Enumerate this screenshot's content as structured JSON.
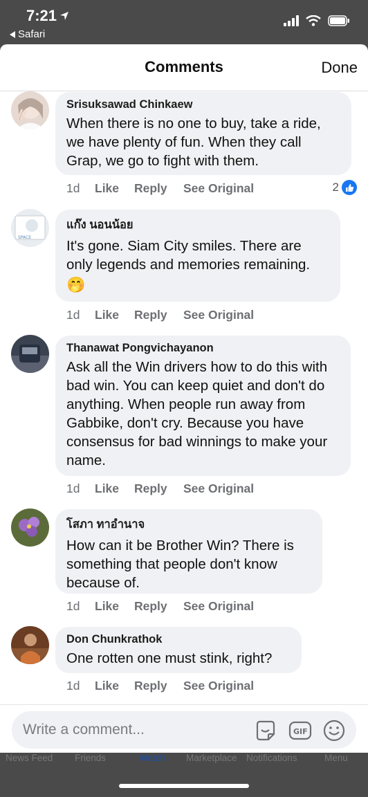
{
  "status_bar": {
    "time": "7:21",
    "back_app": "Safari"
  },
  "sheet": {
    "title": "Comments",
    "done_label": "Done"
  },
  "comments": [
    {
      "author": "Srisuksawad Chinkaew",
      "text": "When there is no one to buy, take a ride, we have plenty of fun. When they call Grap, we go to fight with them.",
      "time": "1d",
      "like": "Like",
      "reply": "Reply",
      "see_original": "See Original",
      "reactions": "2"
    },
    {
      "author": "แก๊ง นอนน้อย",
      "text": "It's gone. Siam City smiles. There are only legends and memories remaining.",
      "emoji": "🤭",
      "time": "1d",
      "like": "Like",
      "reply": "Reply",
      "see_original": "See Original"
    },
    {
      "author": "Thanawat Pongvichayanon",
      "text": "Ask all the Win drivers how to do this with bad win. You can keep quiet and don't do anything. When people run away from Gabbike, don't cry. Because you have consensus for bad winnings to make your name.",
      "time": "1d",
      "like": "Like",
      "reply": "Reply",
      "see_original": "See Original"
    },
    {
      "author": "โสภา ทาอำนาจ",
      "text": "How can it be Brother Win? There is something that people don't know because of.",
      "time": "1d",
      "like": "Like",
      "reply": "Reply",
      "see_original": "See Original"
    },
    {
      "author": "Don Chunkrathok",
      "text": "One rotten one must stink, right?",
      "time": "1d",
      "like": "Like",
      "reply": "Reply",
      "see_original": "See Original"
    }
  ],
  "composer": {
    "placeholder": "Write a comment..."
  },
  "tabbar": {
    "items": [
      "News Feed",
      "Friends",
      "Watch",
      "Marketplace",
      "Notifications",
      "Menu"
    ]
  },
  "colors": {
    "like_blue": "#1877f2",
    "bubble_bg": "#f0f1f4",
    "watch_tab": "#1e4fa8"
  }
}
